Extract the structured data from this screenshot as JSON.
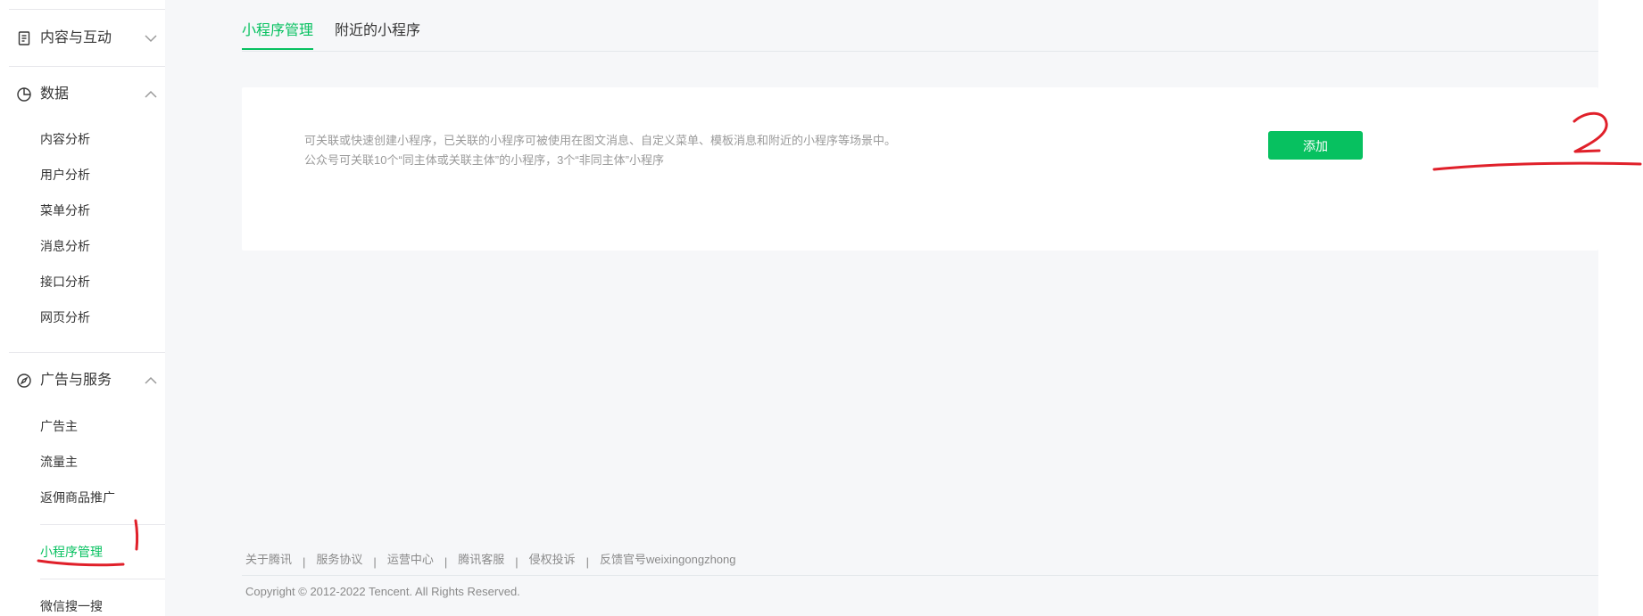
{
  "sidebar": {
    "groups": [
      {
        "label": "内容与互动",
        "icon": "document-icon",
        "expanded": false
      },
      {
        "label": "数据",
        "icon": "pie-chart-icon",
        "expanded": true,
        "items": [
          "内容分析",
          "用户分析",
          "菜单分析",
          "消息分析",
          "接口分析",
          "网页分析"
        ]
      },
      {
        "label": "广告与服务",
        "icon": "compass-icon",
        "expanded": true,
        "items": [
          "广告主",
          "流量主",
          "返佣商品推广"
        ]
      }
    ],
    "mini_program_label": "小程序管理",
    "search_label": "微信搜一搜"
  },
  "tabs": [
    "小程序管理",
    "附近的小程序"
  ],
  "card": {
    "description_line1": "可关联或快速创建小程序，已关联的小程序可被使用在图文消息、自定义菜单、模板消息和附近的小程序等场景中。",
    "description_line2": "公众号可关联10个“同主体或关联主体”的小程序，3个“非同主体”小程序",
    "add_button": "添加"
  },
  "footer": {
    "links": [
      "关于腾讯",
      "服务协议",
      "运营中心",
      "腾讯客服",
      "侵权投诉",
      "反馈官号weixingongzhong"
    ],
    "copyright": "Copyright © 2012-2022 Tencent. All Rights Reserved."
  },
  "annotations": {
    "mark1": "1",
    "mark2": "2",
    "color": "#e0202a"
  },
  "colors": {
    "accent": "#07c160",
    "background": "#f6f7f9",
    "text": "#353535",
    "muted": "#9a9a9a"
  }
}
